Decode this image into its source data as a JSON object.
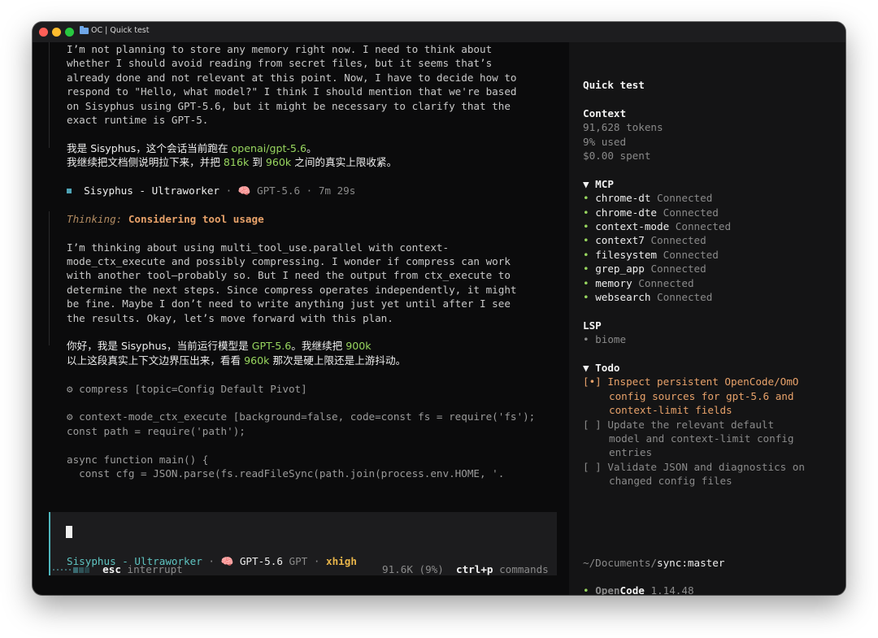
{
  "window": {
    "title": "OC | Quick test"
  },
  "main": {
    "para1": [
      "I’m not planning to store any memory right now. I need to think about",
      "whether I should avoid reading from secret files, but it seems that’s",
      "already done and not relevant at this point. Now, I have to decide how to",
      "respond to \"Hello, what model?\" I think I should mention that we're based",
      "on Sisyphus using GPT-5.6, but it might be necessary to clarify that the",
      "exact runtime is GPT-5."
    ],
    "reply1": {
      "a1": "我是 Sisyphus，这个会话当前跑在 ",
      "a_model": "openai/gpt-5.6",
      "a2": "。",
      "b1": "我继续把文档侧说明拉下来，并把 ",
      "b_v1": "816k",
      "b2": " 到 ",
      "b_v2": "960k",
      "b3": " 之间的真实上限收紧。"
    },
    "meta": {
      "agent": "Sisyphus - Ultraworker",
      "sep1": " · ",
      "brain": "🧠",
      "model": " GPT-5.6",
      "sep2": " · ",
      "duration": "7m 29s"
    },
    "thinking": {
      "label": "Thinking:",
      "title": "Considering tool usage"
    },
    "para2": [
      "I’m thinking about using multi_tool_use.parallel with context-",
      "mode_ctx_execute and possibly compressing. I wonder if compress can work",
      "with another tool—probably so. But I need the output from ctx_execute to",
      "determine the next steps. Since compress operates independently, it might",
      "be fine. Maybe I don’t need to write anything just yet until after I see",
      "the results. Okay, let’s move forward with this plan."
    ],
    "reply2": {
      "a1": "你好，我是 Sisyphus，当前运行模型是 ",
      "a_model": "GPT-5.6",
      "a2": "。我继续把 ",
      "a_v": "900k",
      "b1": "以上这段真实上下文边界压出来，看看 ",
      "b_v": "960k",
      "b2": " 那次是硬上限还是上游抖动。"
    },
    "tool1": "⚙ compress [topic=Config Default Pivot]",
    "tool2": [
      "⚙ context-mode_ctx_execute [background=false, code=const fs = require('fs');",
      "const path = require('path');",
      "",
      "async function main() {",
      "  const cfg = JSON.parse(fs.readFileSync(path.join(process.env.HOME, '."
    ],
    "input_status": {
      "agent": "Sisyphus - Ultraworker",
      "sep1": " · ",
      "brain": "🧠",
      "model": " GPT-5.6",
      "provider": " GPT",
      "sep2": " · ",
      "variant": "xhigh"
    },
    "bottom": {
      "esc_key": "esc",
      "esc_label": " interrupt",
      "usage": "91.6K (9%)",
      "cmd_key": "ctrl+p",
      "cmd_label": " commands"
    }
  },
  "sidebar": {
    "title": "Quick test",
    "context": {
      "heading": "Context",
      "tokens": "91,628 tokens",
      "used": "9% used",
      "spent": "$0.00 spent"
    },
    "mcp": {
      "heading": "▼ MCP",
      "items": [
        {
          "name": "chrome-dt",
          "status": "Connected"
        },
        {
          "name": "chrome-dte",
          "status": "Connected"
        },
        {
          "name": "context-mode",
          "status": "Connected"
        },
        {
          "name": "context7",
          "status": "Connected"
        },
        {
          "name": "filesystem",
          "status": "Connected"
        },
        {
          "name": "grep_app",
          "status": "Connected"
        },
        {
          "name": "memory",
          "status": "Connected"
        },
        {
          "name": "websearch",
          "status": "Connected"
        }
      ]
    },
    "lsp": {
      "heading": "LSP",
      "items": [
        "biome"
      ]
    },
    "todo": {
      "heading": "▼ Todo",
      "items": [
        {
          "box": "[•]",
          "lines": [
            "Inspect persistent OpenCode/OmO",
            "config sources for gpt-5.6 and",
            "context-limit fields"
          ]
        },
        {
          "box": "[ ]",
          "lines": [
            "Update the relevant default",
            "model and context-limit config",
            "entries"
          ]
        },
        {
          "box": "[ ]",
          "lines": [
            "Validate JSON and diagnostics on",
            "changed config files"
          ]
        }
      ]
    },
    "path": {
      "dir": "~/Documents/",
      "repo": "sync:master"
    },
    "version": {
      "app_a": "Open",
      "app_b": "Code",
      "num": "1.14.48"
    }
  }
}
